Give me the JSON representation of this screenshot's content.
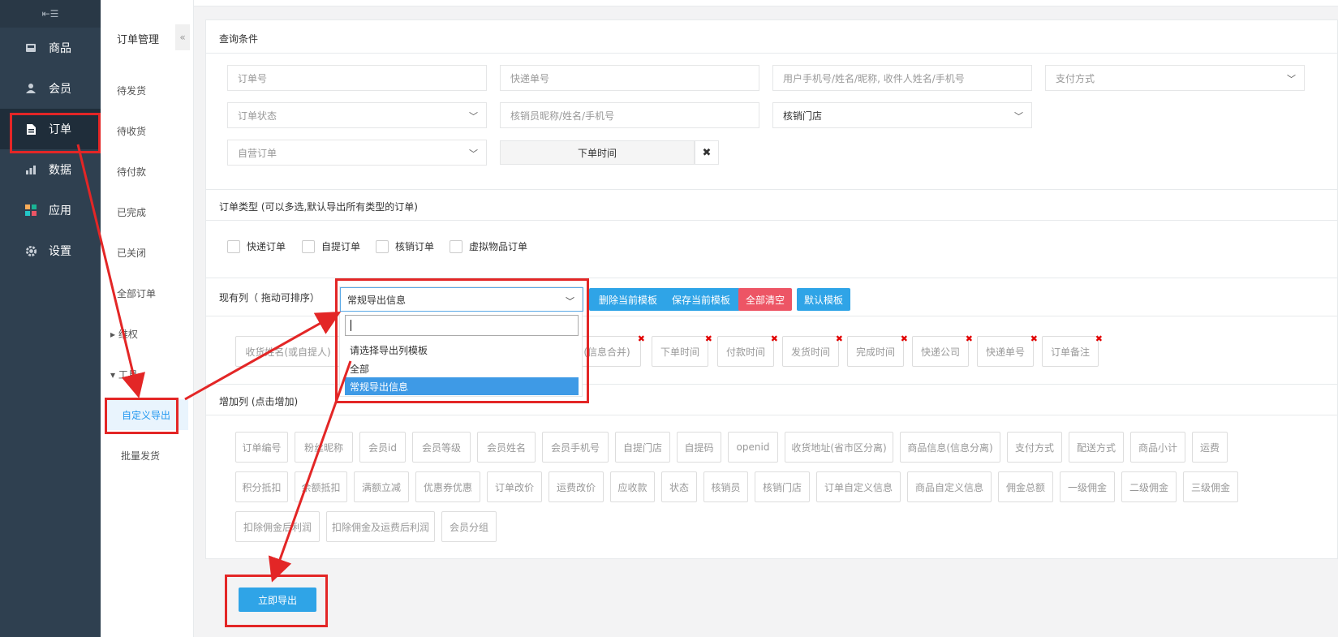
{
  "sidebar": {
    "items": [
      {
        "label": "商品",
        "icon": "inbox-icon"
      },
      {
        "label": "会员",
        "icon": "user-icon"
      },
      {
        "label": "订单",
        "icon": "document-icon"
      },
      {
        "label": "数据",
        "icon": "bar-chart-icon"
      },
      {
        "label": "应用",
        "icon": "apps-icon"
      },
      {
        "label": "设置",
        "icon": "gear-icon"
      }
    ],
    "active": "订单"
  },
  "subnav": {
    "title": "订单管理",
    "items": [
      "待发货",
      "待收货",
      "待付款",
      "已完成",
      "已关闭",
      "全部订单"
    ],
    "group_rights": "维权",
    "group_tools": "工具",
    "tool_items": [
      "自定义导出",
      "批量发货"
    ]
  },
  "query": {
    "title": "查询条件",
    "order_no_placeholder": "订单号",
    "express_no_placeholder": "快递单号",
    "user_placeholder": "用户手机号/姓名/昵称, 收件人姓名/手机号",
    "pay_method": "支付方式",
    "order_status": "订单状态",
    "verifier_placeholder": "核销员昵称/姓名/手机号",
    "verify_store": "核销门店",
    "self_order": "自营订单",
    "order_time_btn": "下单时间",
    "clear_symbol": "✖"
  },
  "order_type": {
    "title": "订单类型 (可以多选,默认导出所有类型的订单)",
    "options": [
      "快递订单",
      "自提订单",
      "核销订单",
      "虚拟物品订单"
    ]
  },
  "columns": {
    "title": "现有列（ 拖动可排序）",
    "template_selected": "常规导出信息",
    "buttons": {
      "delete": "删除当前模板",
      "save": "保存当前模板",
      "clear": "全部清空",
      "default": "默认模板"
    },
    "current": [
      "收货姓名(或自提人)",
      "(信息合并)",
      "下单时间",
      "付款时间",
      "发货时间",
      "完成时间",
      "快递公司",
      "快递单号",
      "订单备注"
    ]
  },
  "dropdown": {
    "options": [
      "请选择导出列模板",
      "全部",
      "常规导出信息"
    ],
    "highlighted": "常规导出信息"
  },
  "add_columns": {
    "title": "增加列 (点击增加)",
    "row1": [
      "订单编号",
      "粉丝昵称",
      "会员id",
      "会员等级",
      "会员姓名",
      "会员手机号",
      "自提门店",
      "自提码",
      "openid",
      "收货地址(省市区分离)",
      "商品信息(信息分离)",
      "支付方式",
      "配送方式",
      "商品小计",
      "运费"
    ],
    "row2": [
      "积分抵扣",
      "余额抵扣",
      "满额立减",
      "优惠券优惠",
      "订单改价",
      "运费改价",
      "应收款",
      "状态",
      "核销员",
      "核销门店",
      "订单自定义信息",
      "商品自定义信息",
      "佣金总额",
      "一级佣金",
      "二级佣金",
      "三级佣金"
    ],
    "row3": [
      "扣除佣金后利润",
      "扣除佣金及运费后利润",
      "会员分组"
    ]
  },
  "export_btn": "立即导出",
  "colors": {
    "sidebar": "#2f4050",
    "primary": "#2fa4e7",
    "danger": "#ed5565",
    "annotation": "#e32626"
  }
}
